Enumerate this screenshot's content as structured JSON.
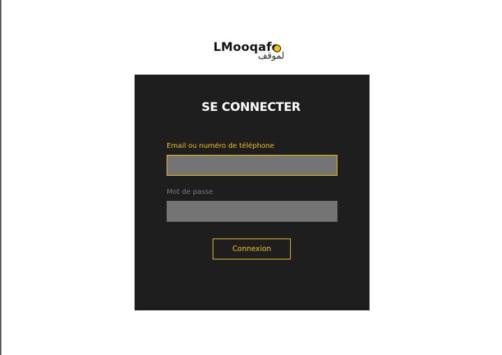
{
  "logo": {
    "text": "LMooqafo",
    "arabic_text": "لموقف",
    "accent_color": "#f2c200"
  },
  "login_form": {
    "title": "SE CONNECTER",
    "email_label": "Email ou numéro de téléphone",
    "email_value": "",
    "password_label": "Mot de passe",
    "password_value": "",
    "submit_label": "Connexion"
  },
  "colors": {
    "card_background": "#1e1e1e",
    "accent": "#f2c200",
    "input_background": "#747474",
    "inactive_label": "#7b7b7b"
  }
}
